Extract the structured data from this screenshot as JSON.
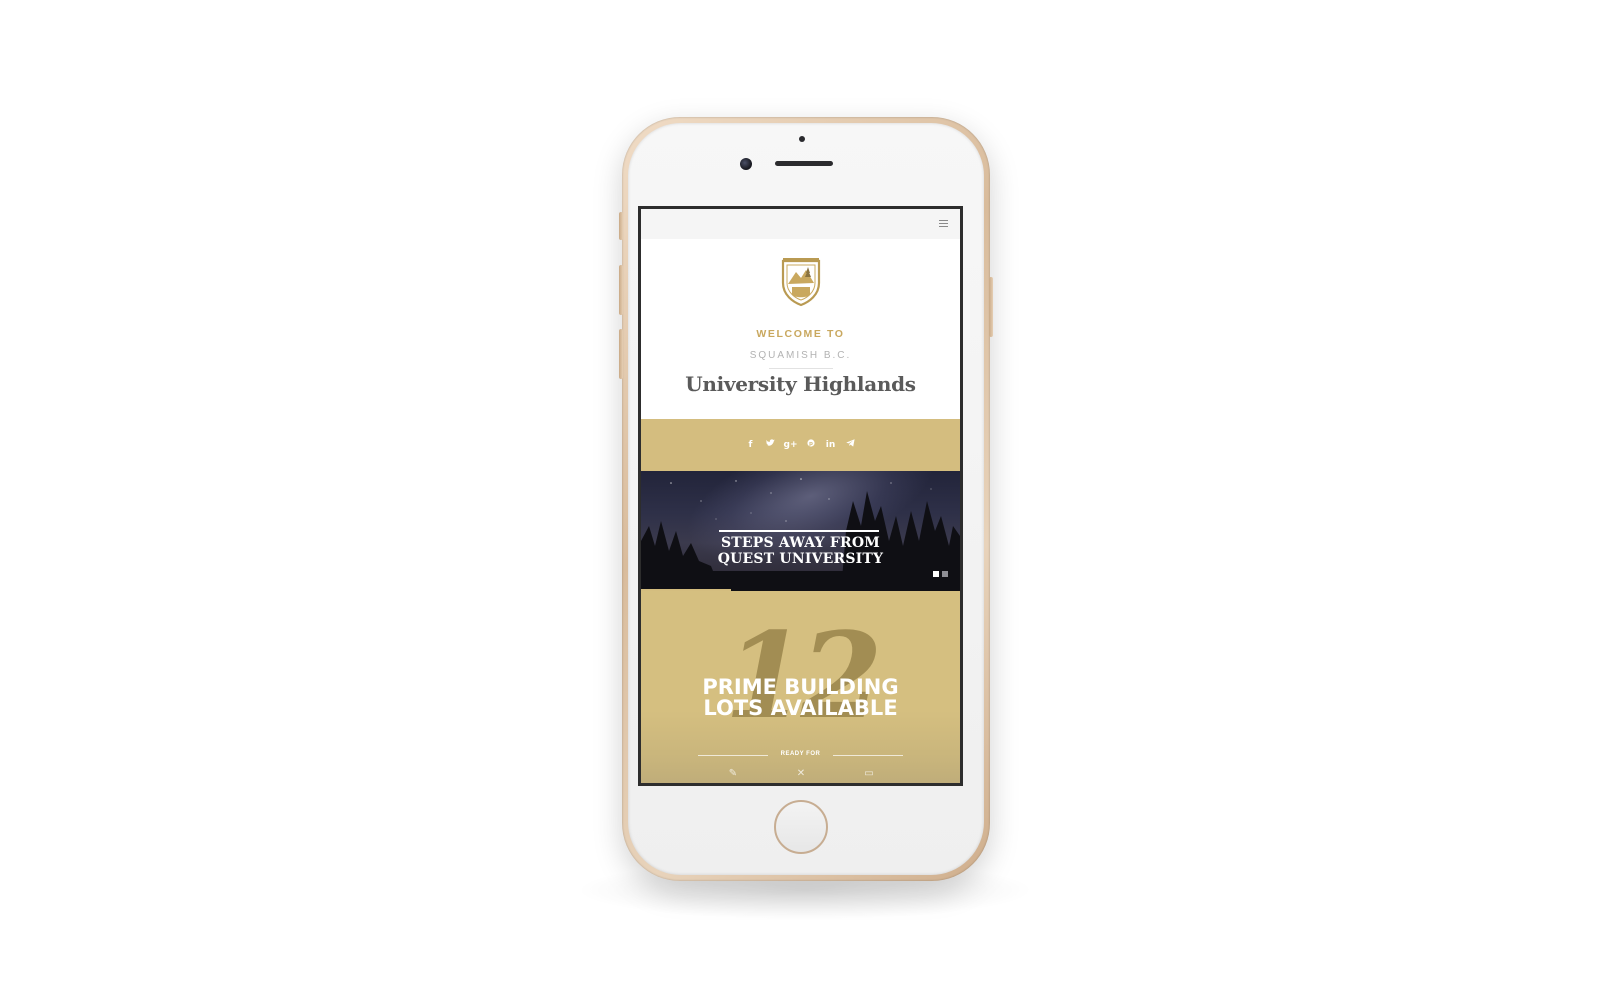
{
  "site": {
    "welcome": "WELCOME TO",
    "location": "SQUAMISH B.C.",
    "title": "University Highlands"
  },
  "nav": {
    "menu_icon": "hamburger-menu-icon"
  },
  "social": [
    {
      "name": "facebook",
      "glyph": "f"
    },
    {
      "name": "twitter",
      "glyph": "🐦"
    },
    {
      "name": "google-plus",
      "glyph": "g+"
    },
    {
      "name": "pinterest",
      "glyph": "p"
    },
    {
      "name": "linkedin",
      "glyph": "in"
    },
    {
      "name": "telegram",
      "glyph": "➤"
    }
  ],
  "hero": {
    "line1": "STEPS AWAY FROM",
    "line2": "QUEST UNIVERSITY",
    "slides": 2,
    "active_slide": 1
  },
  "lots": {
    "number": "12",
    "line1": "PRIME BUILDING",
    "line2": "LOTS AVAILABLE",
    "ready_for": "READY FOR"
  },
  "colors": {
    "gold": "#d4bd7f",
    "welcome_gold": "#c9a85f",
    "title_gray": "#5a5a5a",
    "phone_frame": "#d9bc9c"
  }
}
